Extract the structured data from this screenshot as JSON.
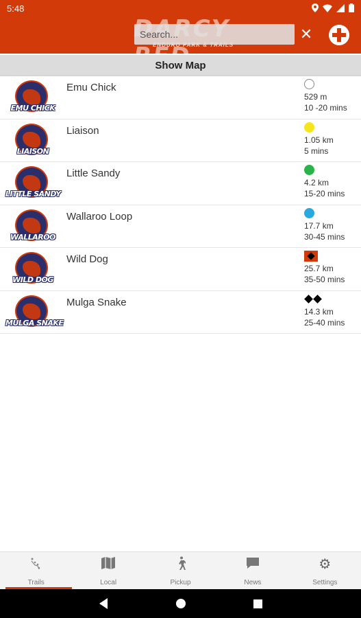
{
  "status_bar": {
    "time": "5:48"
  },
  "brand": {
    "title": "DARCY RED",
    "subtitle": "ENDURO PARK & TRAILS"
  },
  "search": {
    "placeholder": "Search...",
    "value": ""
  },
  "header": {
    "clear_icon": "close-icon",
    "action_icon": "first-aid-icon",
    "accent_color": "#d23a0a"
  },
  "show_map_label": "Show Map",
  "trails": [
    {
      "name": "Emu Chick",
      "logo_text": "EMU CHICK",
      "difficulty": "white-circle",
      "difficulty_color": "#ffffff",
      "distance": "529 m",
      "time": "10 -20 mins"
    },
    {
      "name": "Liaison",
      "logo_text": "LIAISON",
      "difficulty": "yellow-circle",
      "difficulty_color": "#f5e51b",
      "distance": "1.05 km",
      "time": "5 mins"
    },
    {
      "name": "Little Sandy",
      "logo_text": "LITTLE SANDY",
      "difficulty": "green-circle",
      "difficulty_color": "#2bb34b",
      "distance": "4.2 km",
      "time": "15-20 mins"
    },
    {
      "name": "Wallaroo Loop",
      "logo_text": "WALLAROO",
      "difficulty": "blue-circle",
      "difficulty_color": "#29a9e0",
      "distance": "17.7 km",
      "time": "30-45 mins"
    },
    {
      "name": "Wild Dog",
      "logo_text": "WILD DOG",
      "difficulty": "black-diamond-orange-square",
      "difficulty_color": "#d23a0a",
      "distance": "25.7 km",
      "time": "35-50 mins"
    },
    {
      "name": "Mulga Snake",
      "logo_text": "MULGA SNAKE",
      "difficulty": "double-black-diamond",
      "difficulty_color": "#000000",
      "distance": "14.3 km",
      "time": "25-40 mins"
    }
  ],
  "bottom_nav": [
    {
      "label": "Trails",
      "icon": "trails-icon",
      "active": true
    },
    {
      "label": "Local",
      "icon": "map-icon",
      "active": false
    },
    {
      "label": "Pickup",
      "icon": "walking-person-icon",
      "active": false
    },
    {
      "label": "News",
      "icon": "chat-bubble-icon",
      "active": false
    },
    {
      "label": "Settings",
      "icon": "gear-icon",
      "active": false
    }
  ]
}
